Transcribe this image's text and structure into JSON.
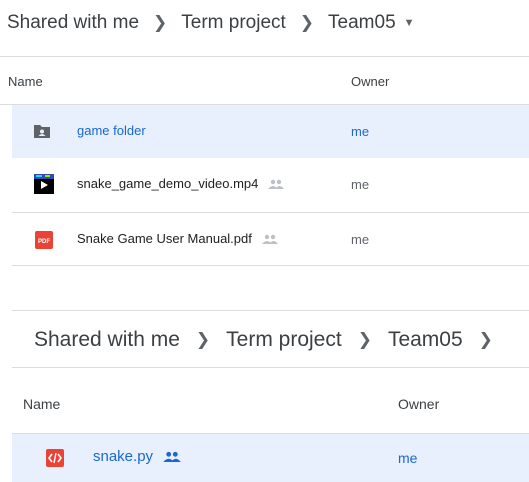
{
  "panel1": {
    "breadcrumb": [
      "Shared with me",
      "Term project",
      "Team05"
    ],
    "separator": ">",
    "columns": {
      "name": "Name",
      "owner": "Owner"
    },
    "files": [
      {
        "name": "game folder",
        "owner": "me",
        "icon": "shared-folder-icon",
        "selected": true,
        "shared": false
      },
      {
        "name": "snake_game_demo_video.mp4",
        "owner": "me",
        "icon": "video-file-icon",
        "selected": false,
        "shared": true
      },
      {
        "name": "Snake Game User Manual.pdf",
        "owner": "me",
        "icon": "pdf-file-icon",
        "selected": false,
        "shared": true
      }
    ]
  },
  "panel2": {
    "breadcrumb": [
      "Shared with me",
      "Term project",
      "Team05"
    ],
    "separator": ">",
    "columns": {
      "name": "Name",
      "owner": "Owner"
    },
    "files": [
      {
        "name": "snake.py",
        "owner": "me",
        "icon": "code-file-icon",
        "selected": true,
        "shared": true
      }
    ]
  },
  "colors": {
    "selected_bg": "#e8f0fe",
    "selected_text": "#1967d2",
    "pdf_red": "#ea4335",
    "folder_gray": "#5f6368"
  },
  "pdf_icon_text": "PDF"
}
